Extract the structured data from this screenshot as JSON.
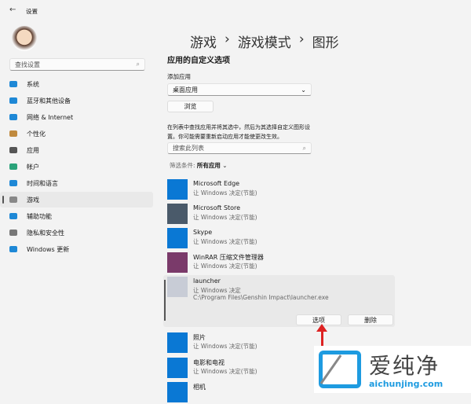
{
  "window": {
    "title": "设置",
    "back_icon": "back-arrow-icon"
  },
  "sidebar": {
    "search_placeholder": "查找设置",
    "items": [
      {
        "label": "系统",
        "color": "#1e88d6"
      },
      {
        "label": "蓝牙和其他设备",
        "color": "#1e88d6"
      },
      {
        "label": "网络 & Internet",
        "color": "#1e88d6"
      },
      {
        "label": "个性化",
        "color": "#c08a3e"
      },
      {
        "label": "应用",
        "color": "#555555"
      },
      {
        "label": "帐户",
        "color": "#2aa37a"
      },
      {
        "label": "时间和语言",
        "color": "#1e88d6"
      },
      {
        "label": "游戏",
        "color": "#888888"
      },
      {
        "label": "辅助功能",
        "color": "#1e88d6"
      },
      {
        "label": "隐私和安全性",
        "color": "#777777"
      },
      {
        "label": "Windows 更新",
        "color": "#1e88d6"
      }
    ],
    "active_index": 7
  },
  "main": {
    "breadcrumb": [
      "游戏",
      "游戏模式",
      "图形"
    ],
    "section_title": "应用的自定义选项",
    "add_app_label": "添加应用",
    "add_app_value": "桌面应用",
    "browse_label": "浏览",
    "description": "在列表中查找应用并将其选中，然后为其选择自定义图形设置。你可能需要重新启动应用才能使更改生效。",
    "search_placeholder": "搜索此列表",
    "filter_label": "筛选条件:",
    "filter_value": "所有应用",
    "apps": [
      {
        "name": "Microsoft Edge",
        "status": "让 Windows 决定(节能)",
        "color": "#0a78d4"
      },
      {
        "name": "Microsoft Store",
        "status": "让 Windows 决定(节能)",
        "color": "#4a5a6a"
      },
      {
        "name": "Skype",
        "status": "让 Windows 决定(节能)",
        "color": "#0a78d4"
      },
      {
        "name": "WinRAR 压缩文件管理器",
        "status": "让 Windows 决定(节能)",
        "color": "#7a3a6a"
      },
      {
        "name": "launcher",
        "status": "让 Windows 决定",
        "path": "C:\\Program Files\\Genshin Impact\\launcher.exe",
        "color": "#c8ccd6"
      },
      {
        "name": "照片",
        "status": "让 Windows 决定(节能)",
        "color": "#0a78d4"
      },
      {
        "name": "电影和电视",
        "status": "让 Windows 决定(节能)",
        "color": "#0a78d4"
      },
      {
        "name": "相机",
        "status": "",
        "color": "#0a78d4"
      }
    ],
    "options_label": "选项",
    "remove_label": "删除"
  },
  "watermark": {
    "text": "爱纯净",
    "url": "aichunjing.com"
  }
}
